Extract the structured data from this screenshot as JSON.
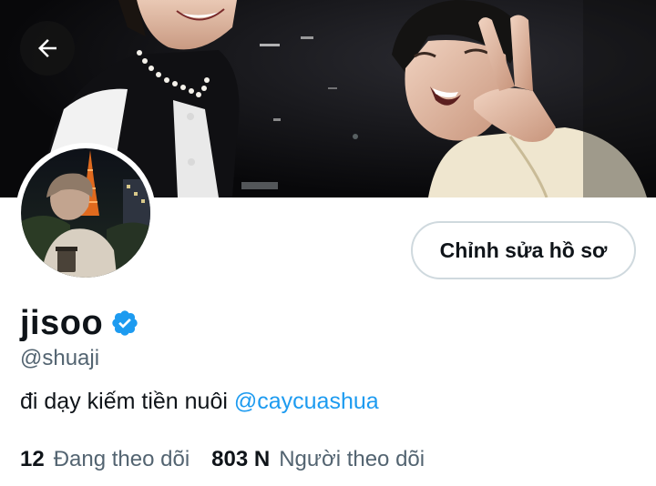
{
  "profile": {
    "display_name": "jisoo",
    "handle": "@shuaji",
    "bio_text": "đi dạy kiếm tiền nuôi",
    "bio_mention": "@caycuashua",
    "verified": true
  },
  "header": {
    "back_icon": "arrow-left-icon"
  },
  "actions": {
    "edit_profile_label": "Chỉnh sửa hồ sơ"
  },
  "stats": {
    "following_count": "12",
    "following_label": "Đang theo dõi",
    "followers_count": "803 N",
    "followers_label": "Người theo dõi"
  },
  "colors": {
    "accent": "#1d9bf0",
    "text_primary": "#0f1419",
    "text_secondary": "#536471",
    "border": "#cfd9de",
    "verified_badge": "#1d9bf0"
  }
}
